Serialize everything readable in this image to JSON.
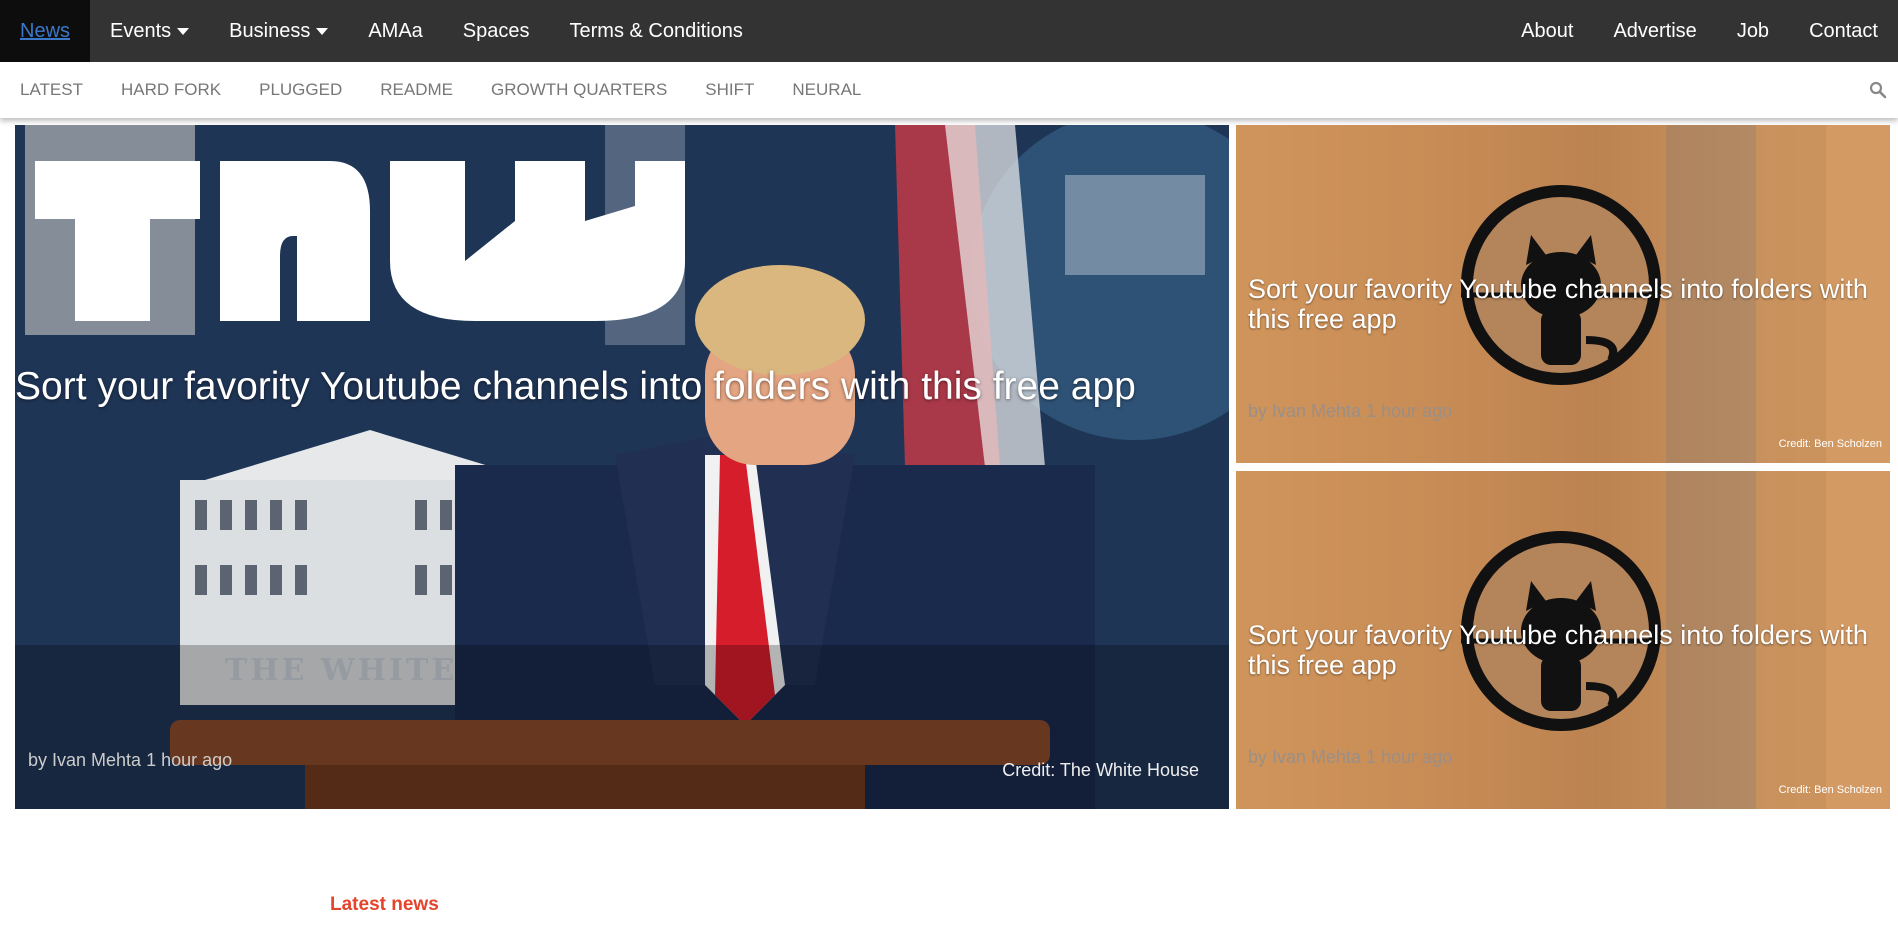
{
  "topnav": {
    "left": [
      {
        "label": "News",
        "active": true
      },
      {
        "label": "Events",
        "caret": true
      },
      {
        "label": "Business",
        "caret": true
      },
      {
        "label": "AMAa"
      },
      {
        "label": "Spaces"
      },
      {
        "label": "Terms & Conditions"
      }
    ],
    "right": [
      {
        "label": "About"
      },
      {
        "label": "Advertise"
      },
      {
        "label": "Job"
      },
      {
        "label": "Contact"
      }
    ]
  },
  "subnav": {
    "items": [
      "LATEST",
      "HARD FORK",
      "PLUGGED",
      "README",
      "GROWTH QUARTERS",
      "SHIFT",
      "NEURAL"
    ],
    "search_icon": "search-icon"
  },
  "hero": {
    "logo": "TNW",
    "title": "Sort your favority Youtube channels into folders with this free app",
    "byline": "by Ivan Mehta 1 hour ago",
    "credit": "Credit: The White House",
    "image_text": "THE WHITE HO"
  },
  "side_articles": [
    {
      "title": "Sort your favority Youtube channels into folders with this free app",
      "byline": "by Ivan Mehta 1 hour ago",
      "credit": "Credit: Ben Scholzen"
    },
    {
      "title": "Sort your favority Youtube channels into folders with this free app",
      "byline": "by Ivan Mehta 1 hour ago",
      "credit": "Credit: Ben Scholzen"
    }
  ],
  "latest_news": {
    "label": "Latest news"
  },
  "colors": {
    "topnav_bg": "#333333",
    "active_link": "#3b78c9",
    "accent": "#e4442c"
  }
}
